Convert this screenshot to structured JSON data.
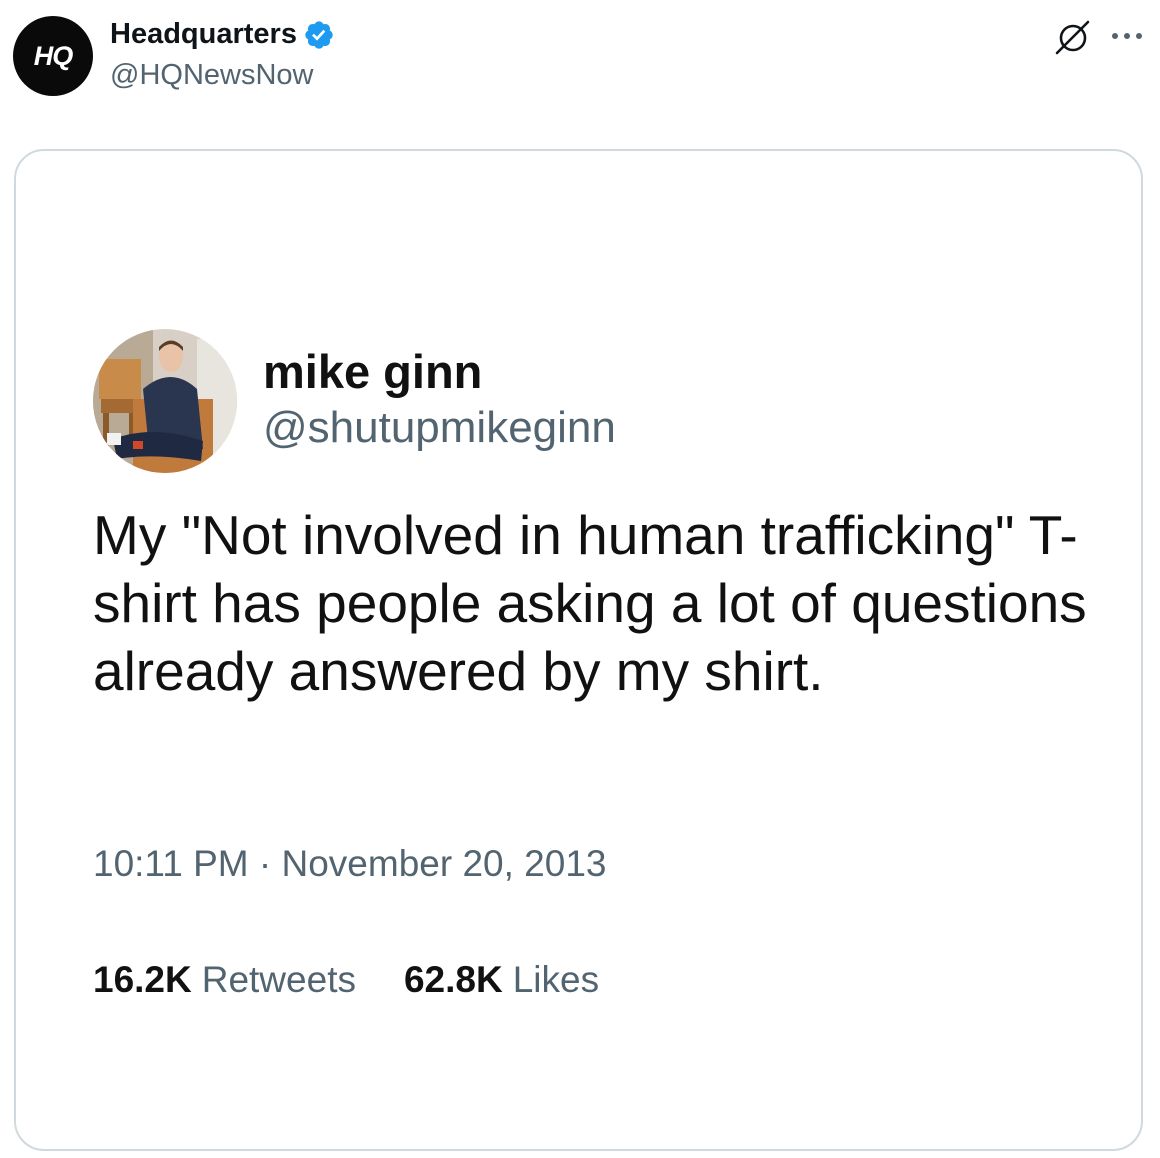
{
  "post": {
    "author_name": "Headquarters",
    "author_handle": "@HQNewsNow",
    "avatar_logo_text": "HQ",
    "verified": true,
    "icons": {
      "verified": "verified-badge-icon",
      "grok": "grok-icon",
      "more": "more-options-icon"
    }
  },
  "quoted_tweet": {
    "name": "mike ginn",
    "handle": "@shutupmikeginn",
    "text": "My \"Not involved in human trafficking\" T-shirt has people asking a lot of questions already answered by my shirt.",
    "timestamp": "10:11 PM · November 20, 2013",
    "retweets_count": "16.2K",
    "retweets_label": "Retweets",
    "likes_count": "62.8K",
    "likes_label": "Likes"
  },
  "colors": {
    "verified_blue": "#1d9bf0",
    "text_primary": "#0f1419",
    "text_secondary": "#536471",
    "card_border": "#cfd9de"
  }
}
